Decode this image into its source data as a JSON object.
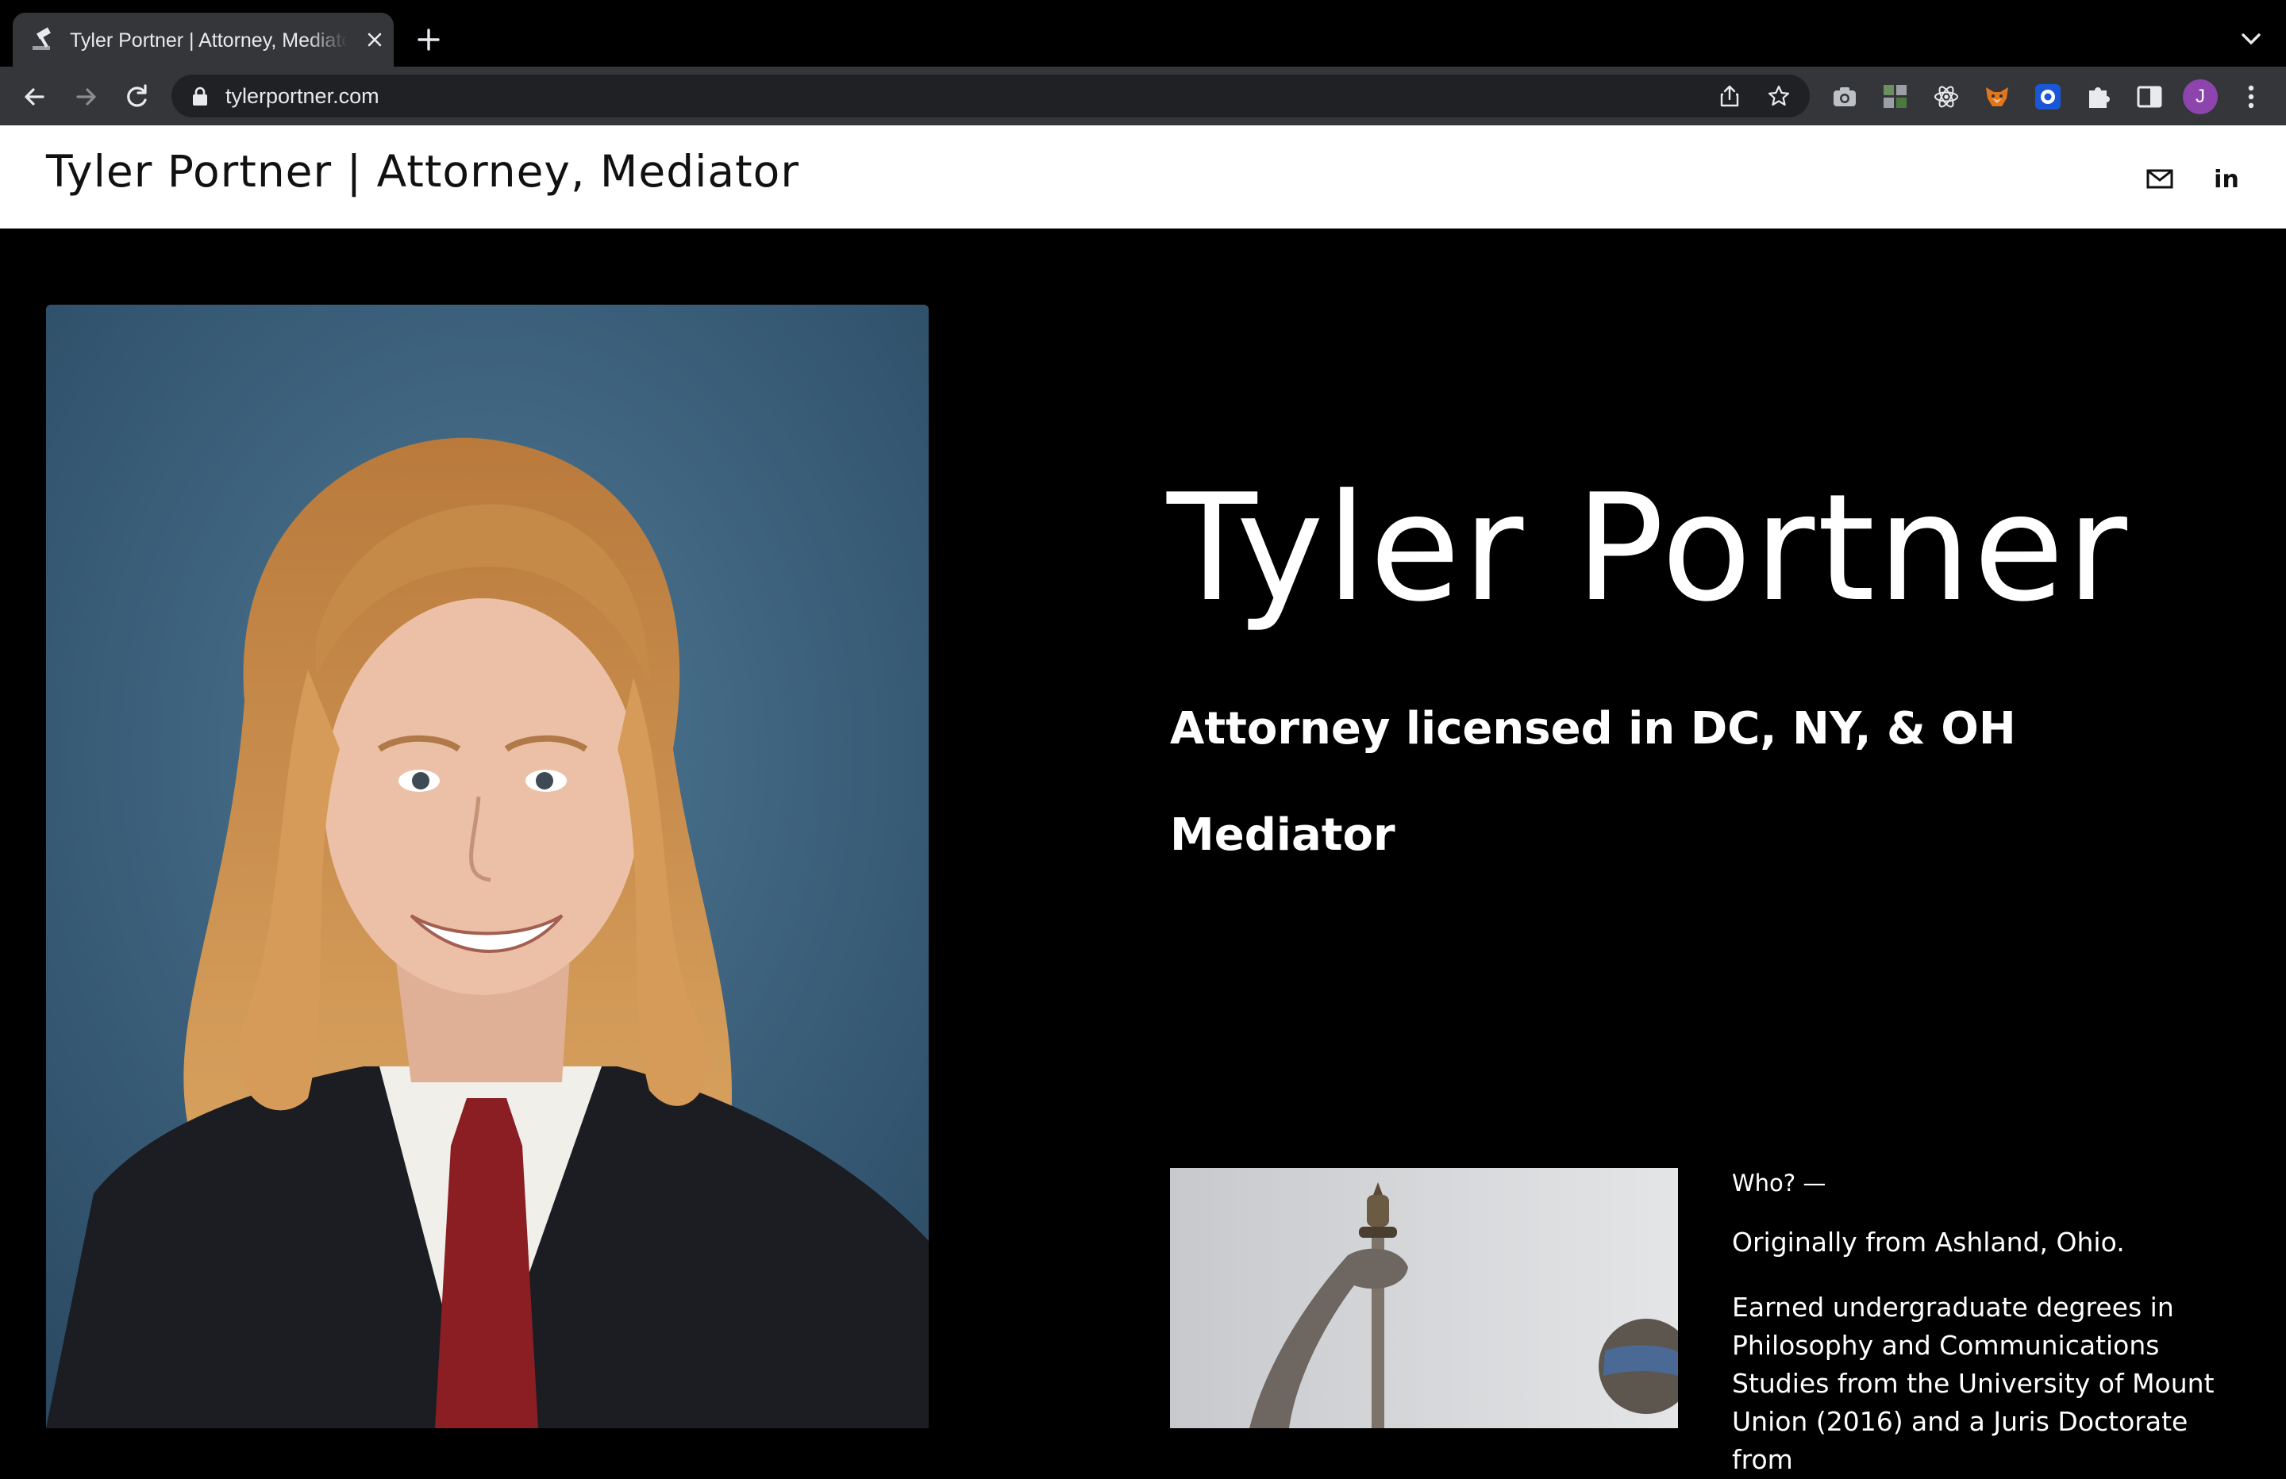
{
  "browser": {
    "tab_title": "Tyler Portner | Attorney, Mediator",
    "url": "tylerportner.com",
    "profile_initial": "J",
    "colors": {
      "chrome_bg": "#000000",
      "toolbar_bg": "#35363a",
      "omnibox_bg": "#202124",
      "avatar": "#8e44ad"
    },
    "extension_icons": [
      "camera-icon",
      "extension-grid-icon",
      "react-atom-icon",
      "fox-icon",
      "circle-ring-icon",
      "puzzle-icon",
      "sidebar-icon"
    ]
  },
  "site": {
    "header_title": "Tyler Portner | Attorney, Mediator",
    "header_icons": [
      "mail-icon",
      "linkedin-icon"
    ],
    "linkedin_label": "in"
  },
  "hero": {
    "name": "Tyler Portner",
    "line1": "Attorney licensed in DC, NY, & OH",
    "line2": "Mediator"
  },
  "about": {
    "heading": "Who? —",
    "origin": "Originally from Ashland, Ohio.",
    "education": "Earned undergraduate degrees in Philosophy and Communications Studies from the University of Mount Union (2016) and a Juris Doctorate from"
  }
}
